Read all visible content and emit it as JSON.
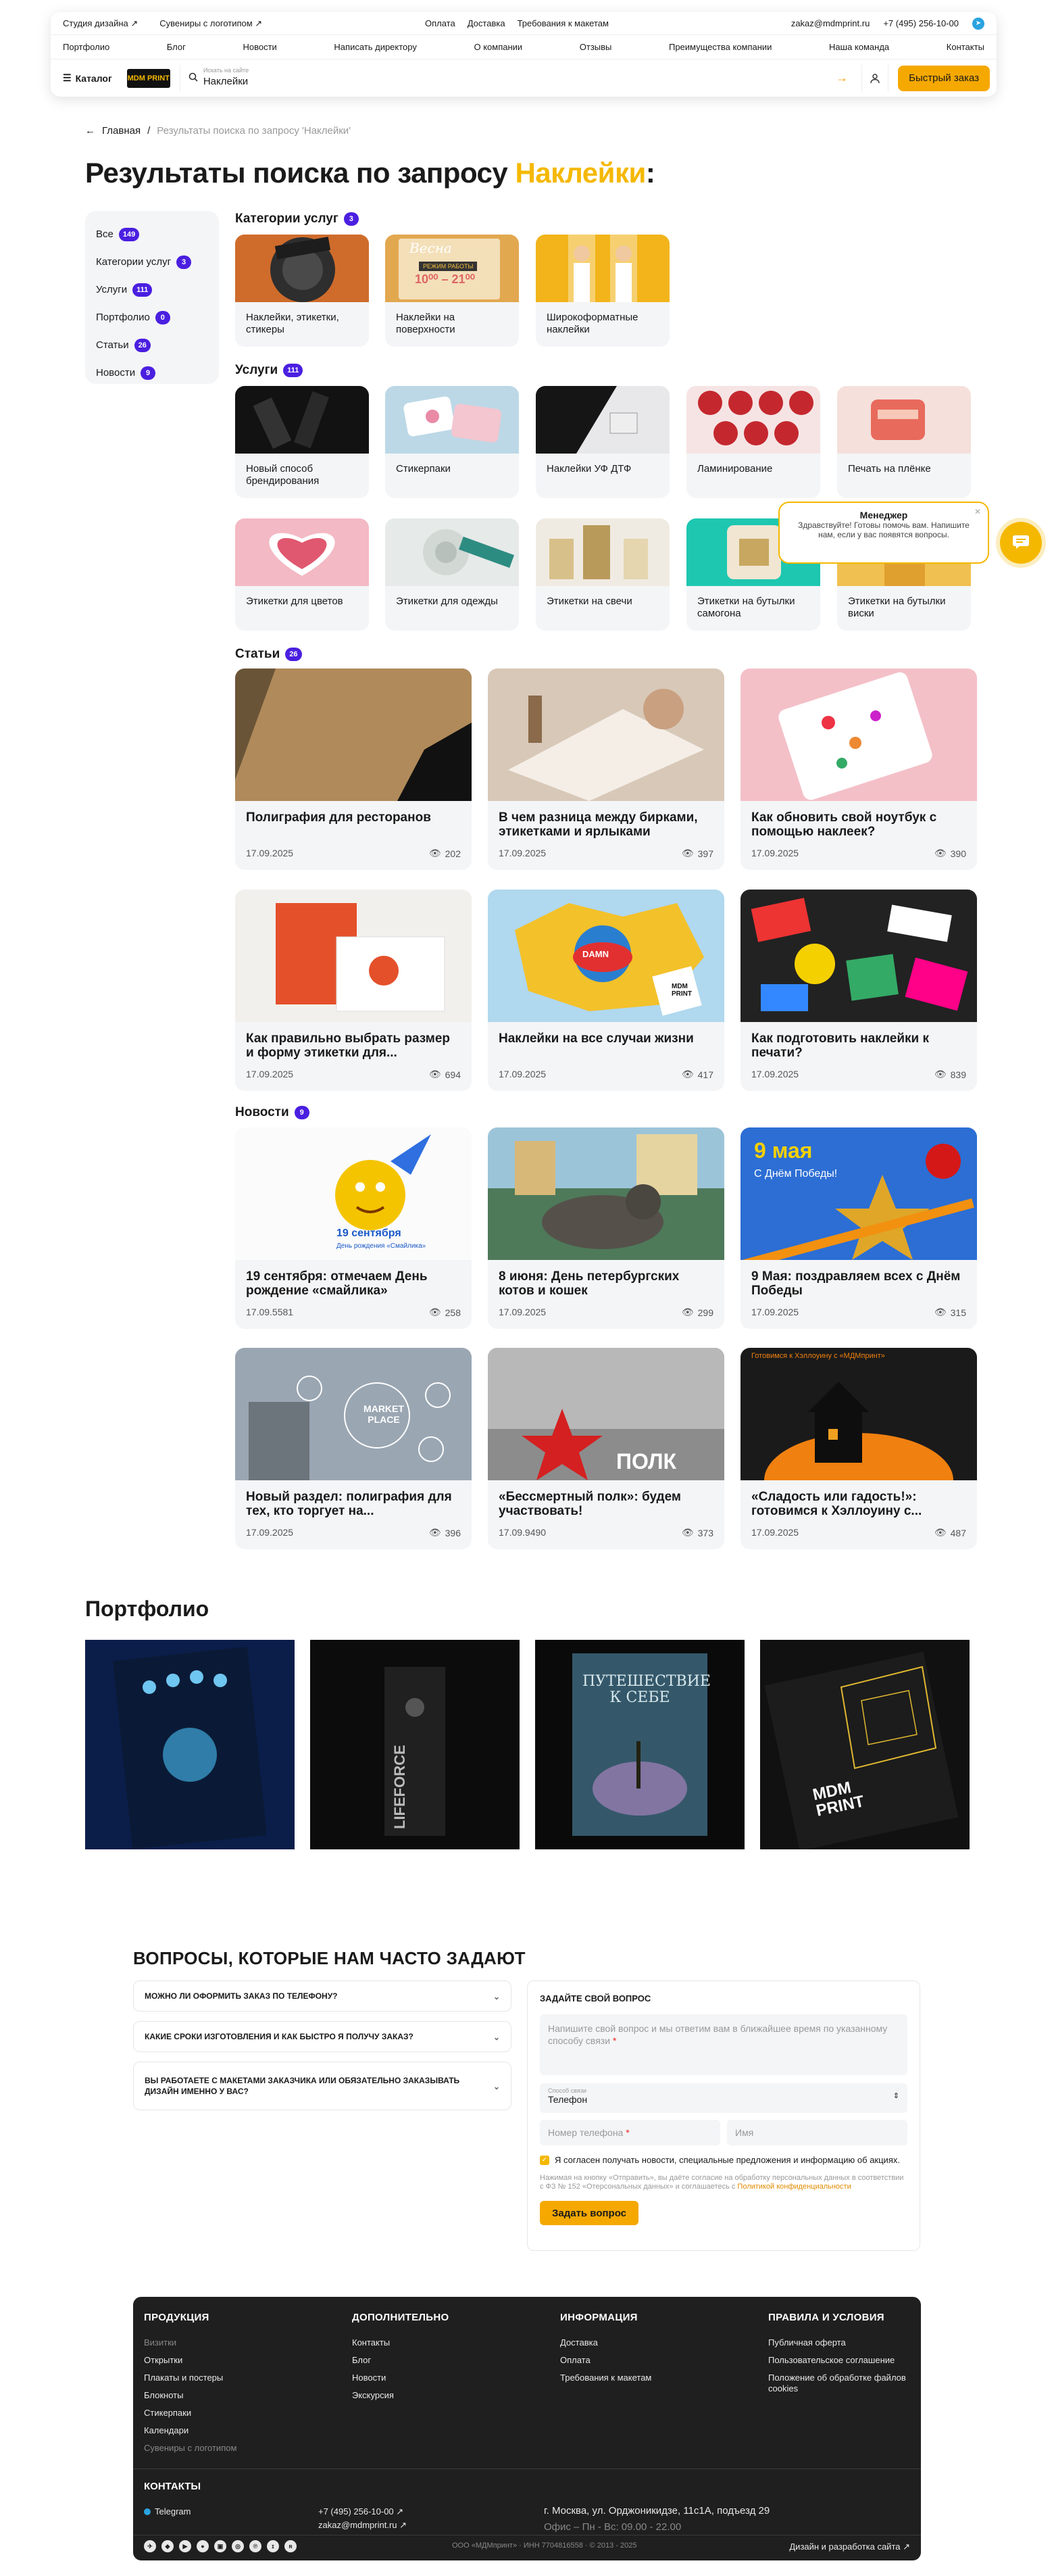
{
  "header": {
    "top_left": [
      "Студия дизайна ↗",
      "Сувениры с логотипом ↗"
    ],
    "top_center": [
      "Оплата",
      "Доставка",
      "Требования к макетам"
    ],
    "email": "zakaz@mdmprint.ru",
    "phone": "+7 (495) 256-10-00",
    "nav": [
      "Портфолио",
      "Блог",
      "Новости",
      "Написать директору",
      "О компании",
      "Отзывы",
      "Преимущества компании",
      "Наша команда",
      "Контакты"
    ],
    "catalog_label": "Каталог",
    "logo_text": "MDM PRINT",
    "search_label": "Искать на сайте",
    "search_value": "Наклейки",
    "quick_order": "Быстрый заказ"
  },
  "breadcrumb": {
    "home": "Главная",
    "current": "Результаты поиска по запросу 'Наклейки'"
  },
  "title": {
    "prefix": "Результаты поиска по запросу ",
    "query": "Наклейки",
    "suffix": ":"
  },
  "sidebar": [
    {
      "label": "Все",
      "count": "149"
    },
    {
      "label": "Категории услуг",
      "count": "3"
    },
    {
      "label": "Услуги",
      "count": "111"
    },
    {
      "label": "Портфолио",
      "count": "0"
    },
    {
      "label": "Статьи",
      "count": "26"
    },
    {
      "label": "Новости",
      "count": "9"
    }
  ],
  "sections": {
    "categories": {
      "title": "Категории услуг",
      "count": "3",
      "items": [
        "Наклейки, этикетки, стикеры",
        "Наклейки на поверхности",
        "Широкоформатные наклейки"
      ]
    },
    "services": {
      "title": "Услуги",
      "count": "111",
      "items": [
        "Новый способ брендирования",
        "Стикерпаки",
        "Наклейки УФ ДТФ",
        "Ламинирование",
        "Печать на плёнке",
        "Этикетки для цветов",
        "Этикетки для одежды",
        "Этикетки на свечи",
        "Этикетки на бутылки самогона",
        "Этикетки на бутылки виски"
      ]
    },
    "articles": {
      "title": "Статьи",
      "count": "26",
      "items": [
        {
          "title": "Полиграфия для ресторанов",
          "date": "17.09.2025",
          "views": "202"
        },
        {
          "title": "В чем разница между бирками, этикетками и ярлыками",
          "date": "17.09.2025",
          "views": "397"
        },
        {
          "title": "Как обновить свой ноутбук с помощью наклеек?",
          "date": "17.09.2025",
          "views": "390"
        },
        {
          "title": "Как правильно выбрать размер и форму этикетки для...",
          "date": "17.09.2025",
          "views": "694"
        },
        {
          "title": "Наклейки на все случаи жизни",
          "date": "17.09.2025",
          "views": "417"
        },
        {
          "title": "Как подготовить наклейки к печати?",
          "date": "17.09.2025",
          "views": "839"
        }
      ]
    },
    "news": {
      "title": "Новости",
      "count": "9",
      "items": [
        {
          "title": "19 сентября: отмечаем День рождение «смайлика»",
          "date": "17.09.5581",
          "views": "258"
        },
        {
          "title": "8 июня: День петербургских котов и кошек",
          "date": "17.09.2025",
          "views": "299"
        },
        {
          "title": "9 Мая: поздравляем всех с Днём Победы",
          "date": "17.09.2025",
          "views": "315"
        },
        {
          "title": "Новый раздел: полиграфия для тех, кто торгует на...",
          "date": "17.09.2025",
          "views": "396"
        },
        {
          "title": "«Бессмертный полк»: будем участвовать!",
          "date": "17.09.9490",
          "views": "373"
        },
        {
          "title": "«Сладость или гадость!»: готовимся к Хэллоуину с...",
          "date": "17.09.2025",
          "views": "487"
        }
      ]
    }
  },
  "image_text": {
    "cat2_a": "Весна",
    "cat2_b": "РЕЖИМ РАБОТЫ",
    "cat2_c": "10⁰⁰ – 21⁰⁰",
    "news1_a": "19 сентября",
    "news1_b": "День рождения «Смайлика»",
    "news3_a": "9 мая",
    "news3_b": "С Днём Победы!",
    "news4": "MARKET PLACE",
    "news5": "ПОЛК",
    "news6": "Готовимся к Хэллоуину с «МДМпринт»",
    "art5": "DAMN",
    "art3": "MDM PRINT"
  },
  "chat": {
    "title": "Менеджер",
    "message": "Здравствуйте! Готовы помочь вам. Напишите нам, если у вас появятся вопросы."
  },
  "portfolio": {
    "title": "Портфолио",
    "items": [
      "",
      "LIFEFORCE",
      "ПУТЕШЕСТВИЕ К СЕБЕ",
      "MDM PRINT"
    ]
  },
  "faq": {
    "title": "ВОПРОСЫ, КОТОРЫЕ НАМ ЧАСТО ЗАДАЮТ",
    "items": [
      "МОЖНО ЛИ ОФОРМИТЬ ЗАКАЗ ПО ТЕЛЕФОНУ?",
      "КАКИЕ СРОКИ ИЗГОТОВЛЕНИЯ И КАК БЫСТРО Я ПОЛУЧУ ЗАКАЗ?",
      "ВЫ РАБОТАЕТЕ С МАКЕТАМИ ЗАКАЗЧИКА ИЛИ ОБЯЗАТЕЛЬНО ЗАКАЗЫВАТЬ ДИЗАЙН ИМЕННО У ВАС?"
    ]
  },
  "form": {
    "title": "ЗАДАЙТЕ СВОЙ ВОПРОС",
    "question_placeholder": "Напишите свой вопрос и мы ответим вам в ближайшее время по указанному способу связи",
    "contact_label": "Способ связи",
    "contact_value": "Телефон",
    "phone_placeholder": "Номер телефона",
    "name_placeholder": "Имя",
    "consent": "Я согласен получать новости, специальные предложения и информацию об акциях.",
    "fine": "Нажимая на кнопку «Отправить», вы даёте согласие на обработку персональных данных в соответствии с ФЗ № 152 «Отерсональных данных» и соглашаетесь с ",
    "fine_link": "Политикой конфиденциальности",
    "submit": "Задать вопрос"
  },
  "footer": {
    "columns": [
      {
        "title": "ПРОДУКЦИЯ",
        "items": [
          "Визитки",
          "Открытки",
          "Плакаты и постеры",
          "Блокноты",
          "Стикерпаки",
          "Календари",
          "Сувениры с логотипом"
        ]
      },
      {
        "title": "ДОПОЛНИТЕЛЬНО",
        "items": [
          "Контакты",
          "Блог",
          "Новости",
          "Экскурсия"
        ]
      },
      {
        "title": "ИНФОРМАЦИЯ",
        "items": [
          "Доставка",
          "Оплата",
          "Требования к макетам"
        ]
      },
      {
        "title": "ПРАВИЛА И УСЛОВИЯ",
        "items": [
          "Публичная оферта",
          "Пользовательское соглашение",
          "Положение об обработке файлов cookies"
        ]
      }
    ],
    "contacts_title": "КОНТАКТЫ",
    "telegram": "Telegram",
    "phone": "+7 (495) 256-10-00 ↗",
    "email": "zakaz@mdmprint.ru ↗",
    "address": "г. Москва, ул. Орджоникидзе, 11с1А, подъезд 29",
    "hours": "Офис – Пн - Вс: 09.00 - 22.00",
    "legal": "ООО «МДМпринт» · ИНН 7704816558 · © 2013 - 2025",
    "dev": "Дизайн и разработка сайта ↗",
    "social": [
      "✈",
      "◆",
      "▶",
      "●",
      "▣",
      "◎",
      "℗",
      "ɪ",
      "ʀ"
    ]
  },
  "colors": {
    "accent": "#f5b800",
    "badge": "#4a1fe0",
    "card_bg": "#f4f5f7",
    "footer_bg": "#1f1f1f"
  }
}
